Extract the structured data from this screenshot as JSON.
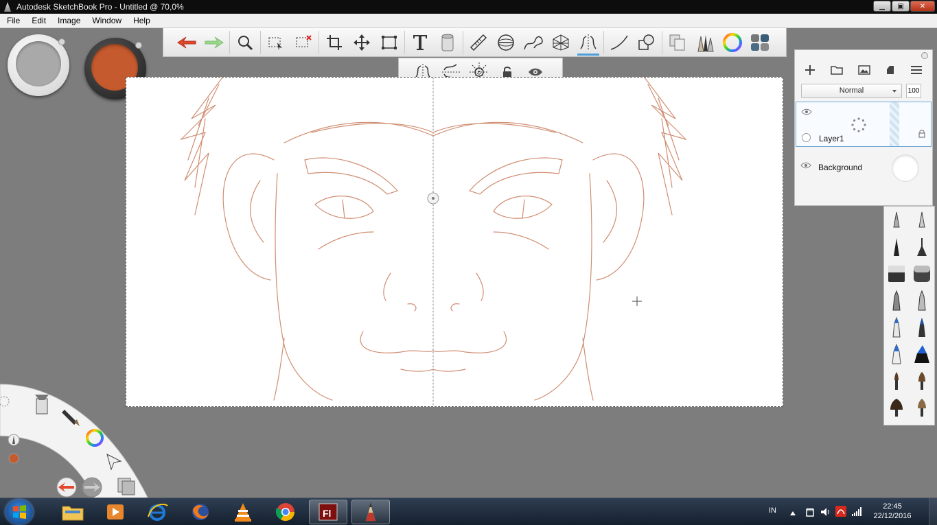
{
  "window": {
    "title": "Autodesk SketchBook Pro - Untitled @ 70,0%",
    "minimize": "▁",
    "maximize": "▣",
    "close": "✕"
  },
  "menu": [
    "File",
    "Edit",
    "Image",
    "Window",
    "Help"
  ],
  "toolbar": {
    "icons": [
      "undo-icon",
      "redo-icon",
      "zoom-icon",
      "lasso-select-icon",
      "magic-select-icon",
      "crop-icon",
      "move-icon",
      "transform-icon",
      "text-icon",
      "fill-bucket-icon",
      "ruler-icon",
      "ellipse-icon",
      "french-curve-icon",
      "perspective-icon",
      "symmetry-icon",
      "stroke-icon",
      "shape-icon",
      "copy-paste-icon",
      "brush-library-icon",
      "color-wheel-icon",
      "palette-icon"
    ],
    "active": "symmetry-icon"
  },
  "symmetry_toolbar": {
    "icons": [
      "symmetry-x-icon",
      "symmetry-y-icon",
      "radial-symmetry-icon",
      "lock-icon",
      "visibility-icon"
    ],
    "active": "symmetry-x-icon"
  },
  "colors": {
    "current_color": "#c45a2d",
    "secondary_color": "#a9a9a9",
    "sketch_stroke": "#c87a5a",
    "accent": "#4a9fd8"
  },
  "layers": {
    "blend_mode": "Normal",
    "opacity": "100",
    "items": [
      {
        "name": "Layer1",
        "selected": true
      },
      {
        "name": "Background",
        "selected": false
      }
    ]
  },
  "taskbar": {
    "apps": [
      "file-explorer",
      "media-player",
      "internet-explorer",
      "firefox",
      "vlc",
      "chrome",
      "flash",
      "sketchbook"
    ],
    "language": "IN",
    "time": "22:45",
    "date": "22/12/2016"
  }
}
